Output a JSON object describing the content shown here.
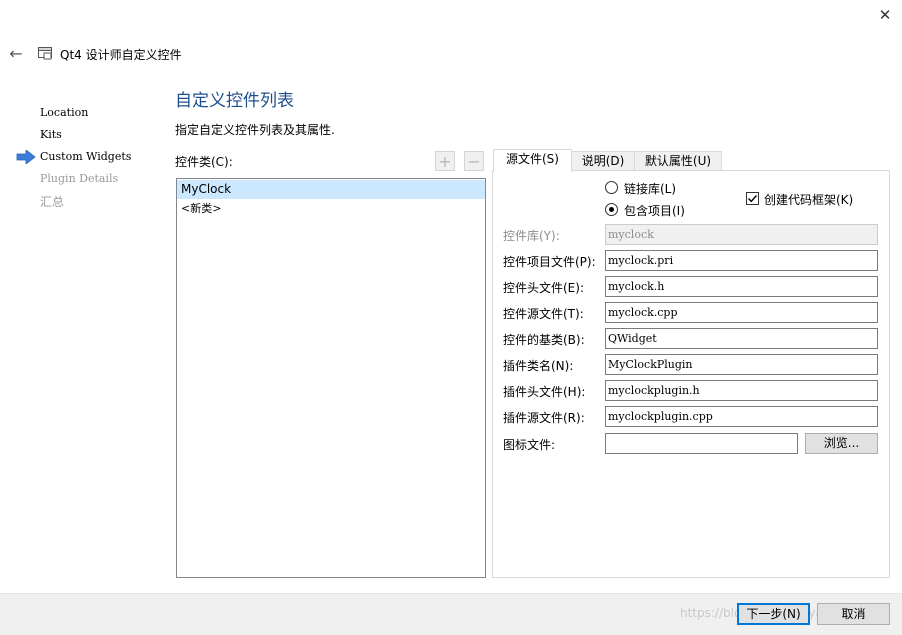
{
  "window": {
    "title": "Qt4 设计师自定义控件",
    "close_symbol": "✕",
    "back_symbol": "←"
  },
  "steps": [
    {
      "label": "Location",
      "state": "done"
    },
    {
      "label": "Kits",
      "state": "done"
    },
    {
      "label": "Custom Widgets",
      "state": "current"
    },
    {
      "label": "Plugin Details",
      "state": "pending"
    },
    {
      "label": "汇总",
      "state": "pending"
    }
  ],
  "header": {
    "title": "自定义控件列表",
    "subtitle": "指定自定义控件列表及其属性."
  },
  "class_list": {
    "label": "控件类(C):",
    "add_symbol": "+",
    "remove_symbol": "−",
    "items": [
      "MyClock",
      "<新类>"
    ],
    "selected_index": 0
  },
  "tabs": [
    {
      "label": "源文件(S)",
      "active": true
    },
    {
      "label": "说明(D)",
      "active": false
    },
    {
      "label": "默认属性(U)",
      "active": false
    }
  ],
  "source_tab": {
    "radio_link": {
      "label": "链接库(L)",
      "checked": false
    },
    "radio_include": {
      "label": "包含项目(I)",
      "checked": true
    },
    "checkbox_skeleton": {
      "label": "创建代码框架(K)",
      "checked": true
    },
    "fields": [
      {
        "label": "控件库(Y):",
        "value": "myclock",
        "disabled": true
      },
      {
        "label": "控件项目文件(P):",
        "value": "myclock.pri",
        "disabled": false
      },
      {
        "label": "控件头文件(E):",
        "value": "myclock.h",
        "disabled": false
      },
      {
        "label": "控件源文件(T):",
        "value": "myclock.cpp",
        "disabled": false
      },
      {
        "label": "控件的基类(B):",
        "value": "QWidget",
        "disabled": false
      },
      {
        "label": "插件类名(N):",
        "value": "MyClockPlugin",
        "disabled": false
      },
      {
        "label": "插件头文件(H):",
        "value": "myclockplugin.h",
        "disabled": false
      },
      {
        "label": "插件源文件(R):",
        "value": "myclockplugin.cpp",
        "disabled": false
      }
    ],
    "icon_file": {
      "label": "图标文件:",
      "value": "",
      "browse_label": "浏览..."
    }
  },
  "footer": {
    "next_label": "下一步(N)",
    "cancel_label": "取消",
    "watermark": "https://blog.csdn.net/yao5302"
  },
  "colors": {
    "accent": "#0078d7",
    "title": "#1f4e8f",
    "selection": "#cce8ff",
    "step_arrow": "#3b7dd8"
  }
}
